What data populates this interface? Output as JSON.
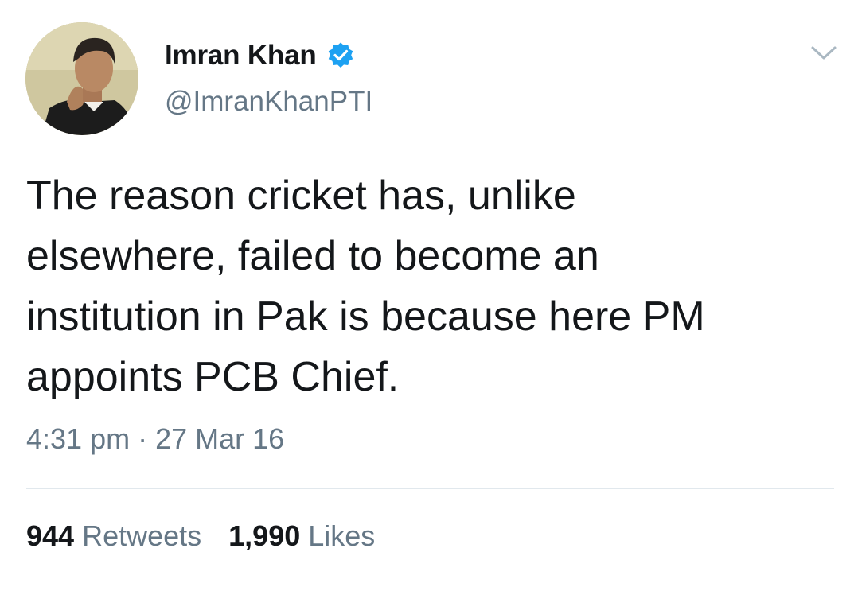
{
  "author": {
    "display_name": "Imran Khan",
    "handle": "@ImranKhanPTI",
    "verified": true
  },
  "tweet": {
    "text_lines": [
      "The reason cricket has, unlike",
      "elsewhere, failed to become an",
      "institution in Pak is because here PM",
      "appoints PCB Chief."
    ],
    "timestamp": "4:31 pm · 27 Mar 16"
  },
  "stats": {
    "retweets": {
      "count": "944",
      "label": "Retweets"
    },
    "likes": {
      "count": "1,990",
      "label": "Likes"
    }
  },
  "colors": {
    "verified_blue": "#1da1f2",
    "secondary_text": "#657786",
    "primary_text": "#14171a",
    "divider": "#e1e8ed"
  },
  "icons": {
    "verified": "verified-badge-icon",
    "menu": "chevron-down-icon"
  }
}
